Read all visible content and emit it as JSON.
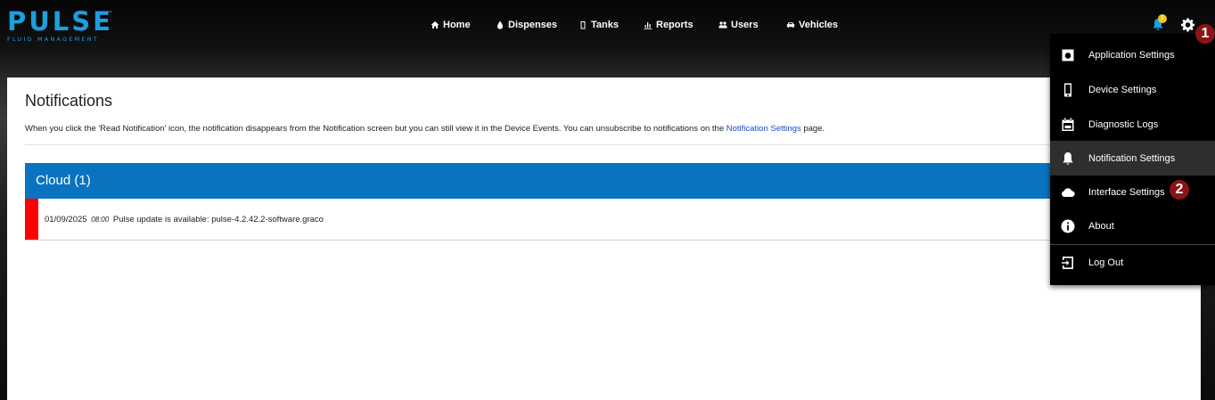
{
  "brand": {
    "name": "PULSE",
    "tm": "™",
    "tagline": "FLUID MANAGEMENT",
    "color": "#1a9fe0"
  },
  "nav": [
    {
      "label": "Home",
      "icon": "home-icon"
    },
    {
      "label": "Dispenses",
      "icon": "droplet-icon"
    },
    {
      "label": "Tanks",
      "icon": "tank-icon"
    },
    {
      "label": "Reports",
      "icon": "bar-chart-icon"
    },
    {
      "label": "Users",
      "icon": "users-icon"
    },
    {
      "label": "Vehicles",
      "icon": "car-icon"
    }
  ],
  "notifications_badge": "1",
  "steps": {
    "one": "1",
    "two": "2"
  },
  "page": {
    "title": "Notifications",
    "desc_before": "When you click the 'Read Notification' icon, the notification disappears from the Notification screen but you can still view it in the Device Events. You can unsubscribe to notifications on the ",
    "desc_link": "Notification Settings",
    "desc_after": " page."
  },
  "group": {
    "title": "Cloud (1)",
    "color": "#0a73c0"
  },
  "notification": {
    "date": "01/09/2025",
    "time": "08:00",
    "message": "Pulse update is available: pulse-4.2.42.2-software.graco",
    "severity_color": "#ff0000"
  },
  "menu": [
    {
      "label": "Application Settings",
      "icon": "settings-box-icon"
    },
    {
      "label": "Device Settings",
      "icon": "phone-icon"
    },
    {
      "label": "Diagnostic Logs",
      "icon": "calendar-icon"
    },
    {
      "label": "Notification Settings",
      "icon": "bell-icon",
      "active": true
    },
    {
      "label": "Interface Settings",
      "icon": "cloud-icon"
    },
    {
      "label": "About",
      "icon": "info-icon"
    },
    {
      "label": "Log Out",
      "icon": "logout-icon"
    }
  ]
}
